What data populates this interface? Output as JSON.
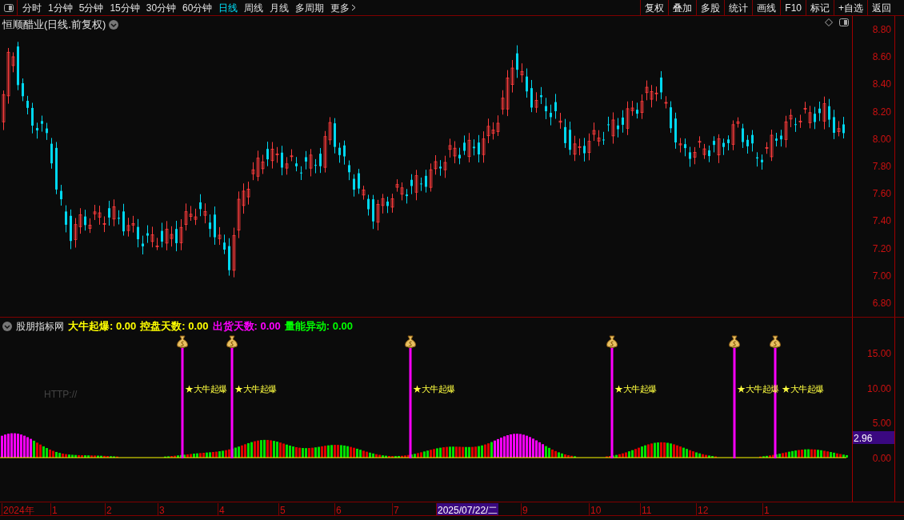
{
  "toolbar": {
    "periods": [
      {
        "label": "分时",
        "selected": false
      },
      {
        "label": "1分钟",
        "selected": false
      },
      {
        "label": "5分钟",
        "selected": false
      },
      {
        "label": "15分钟",
        "selected": false
      },
      {
        "label": "30分钟",
        "selected": false
      },
      {
        "label": "60分钟",
        "selected": false
      },
      {
        "label": "日线",
        "selected": true
      },
      {
        "label": "周线",
        "selected": false
      },
      {
        "label": "月线",
        "selected": false
      },
      {
        "label": "多周期",
        "selected": false
      },
      {
        "label": "更多",
        "selected": false
      }
    ],
    "buttons": [
      "复权",
      "叠加",
      "多股",
      "统计",
      "画线",
      "F10",
      "标记",
      "+自选",
      "返回"
    ]
  },
  "main_chart": {
    "title": "恒顺醋业(日线.前复权)",
    "y_ticks": [
      "8.80",
      "8.60",
      "8.40",
      "8.20",
      "8.00",
      "7.80",
      "7.60",
      "7.40",
      "7.20",
      "7.00",
      "6.80"
    ]
  },
  "indicator": {
    "name": "股朋指标网",
    "values": [
      {
        "label": "大牛起爆: 0.00",
        "color": "#ffff00"
      },
      {
        "label": "控盘天数: 0.00",
        "color": "#ffff00"
      },
      {
        "label": "出货天数: 0.00",
        "color": "#ff00ff"
      },
      {
        "label": "量能异动: 0.00",
        "color": "#00ff00"
      }
    ],
    "signals": [
      {
        "label": "★大牛起爆"
      },
      {
        "label": "★大牛起爆"
      },
      {
        "label": "★大牛起爆"
      },
      {
        "label": "★大牛起爆"
      },
      {
        "label": "★大牛起爆"
      },
      {
        "label": "★大牛起爆"
      }
    ],
    "faint_text": "HTTP://",
    "y_ticks": [
      "15.00",
      "10.00",
      "5.00",
      "0.00"
    ],
    "current_value": "2.96"
  },
  "date_axis": [
    {
      "label": "2024年",
      "selected": false
    },
    {
      "label": "1",
      "selected": false
    },
    {
      "label": "2",
      "selected": false
    },
    {
      "label": "3",
      "selected": false
    },
    {
      "label": "4",
      "selected": false
    },
    {
      "label": "5",
      "selected": false
    },
    {
      "label": "6",
      "selected": false
    },
    {
      "label": "7",
      "selected": false
    },
    {
      "label": "2025/07/22/二",
      "selected": true
    },
    {
      "label": "9",
      "selected": false
    },
    {
      "label": "10",
      "selected": false
    },
    {
      "label": "11",
      "selected": false
    },
    {
      "label": "12",
      "selected": false
    },
    {
      "label": "1",
      "selected": false
    }
  ]
}
